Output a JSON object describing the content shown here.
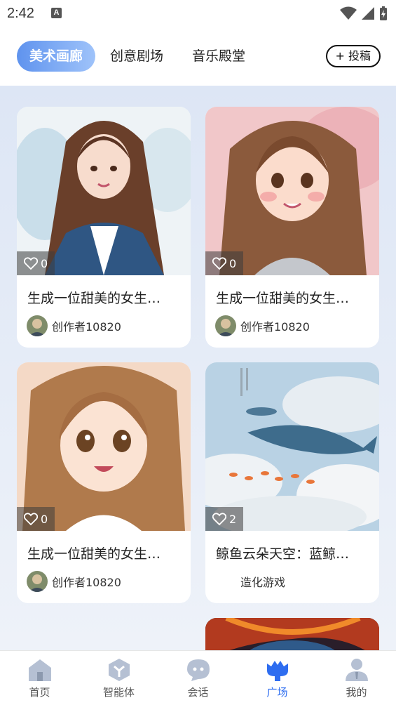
{
  "status_bar": {
    "time": "2:42",
    "notif_letter": "A"
  },
  "tabs": [
    {
      "label": "美术画廊",
      "active": true
    },
    {
      "label": "创意剧场",
      "active": false
    },
    {
      "label": "音乐殿堂",
      "active": false
    }
  ],
  "submit_button": "+ 投稿",
  "cards": [
    {
      "title": "生成一位甜美的女生…",
      "likes": "0",
      "author": "创作者10820"
    },
    {
      "title": "生成一位甜美的女生…",
      "likes": "0",
      "author": "创作者10820"
    },
    {
      "title": "生成一位甜美的女生…",
      "likes": "0",
      "author": "创作者10820"
    },
    {
      "title": "鲸鱼云朵天空：蓝鲸…",
      "likes": "2",
      "author": "造化游戏"
    }
  ],
  "bottom_nav": [
    {
      "label": "首页",
      "icon": "home-icon"
    },
    {
      "label": "智能体",
      "icon": "agent-icon"
    },
    {
      "label": "会话",
      "icon": "chat-icon"
    },
    {
      "label": "广场",
      "icon": "plaza-icon",
      "active": true
    },
    {
      "label": "我的",
      "icon": "profile-icon"
    }
  ],
  "colors": {
    "accent": "#2e6df0",
    "tab_gradient_start": "#5f93ee",
    "tab_gradient_end": "#9fc3fa",
    "feed_bg": "#dde6f5"
  }
}
